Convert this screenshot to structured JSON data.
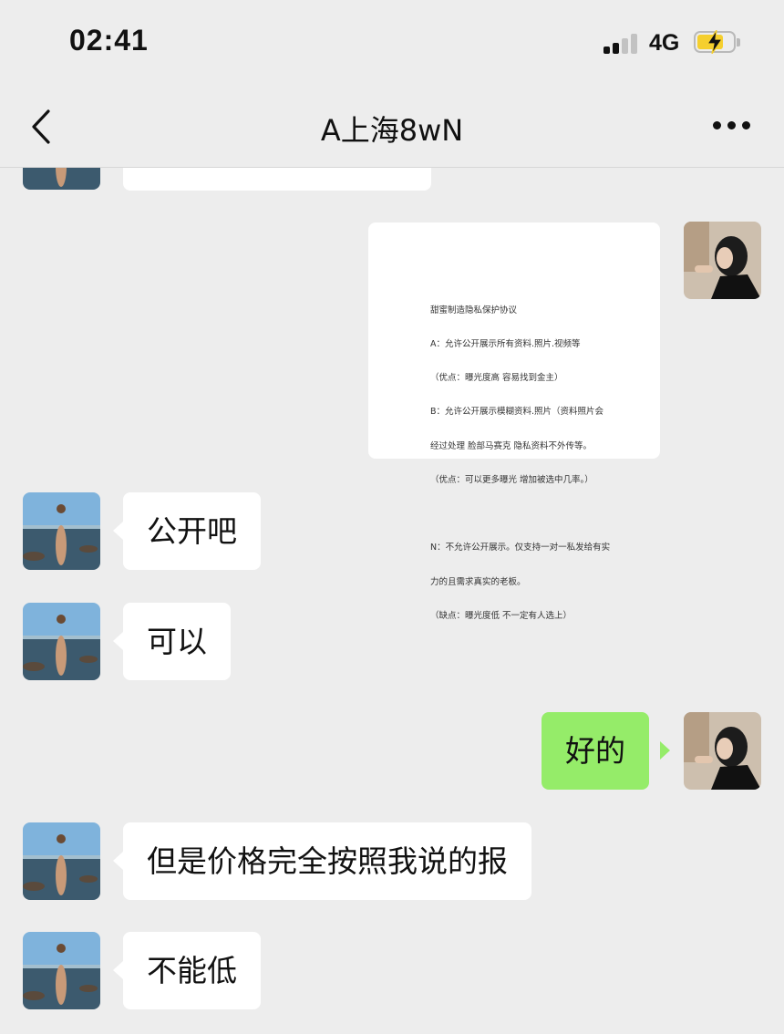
{
  "status_bar": {
    "time": "02:41",
    "network": "4G"
  },
  "nav": {
    "title": "A上海8wN"
  },
  "image_message": {
    "lines": [
      "甜蜜制造隐私保护协议",
      "A：允许公开展示所有资料.照片.视频等",
      "（优点：曝光度高 容易找到金主）",
      "B：允许公开展示模糊资料.照片（资料照片会",
      "经过处理 脸部马赛克 隐私资料不外传等。",
      "（优点：可以更多曝光 增加被选中几率。）",
      "",
      "N：不允许公开展示。仅支持一对一私发给有实",
      "力的且需求真实的老板。",
      "（缺点：曝光度低 不一定有人选上）"
    ]
  },
  "messages": [
    {
      "side": "left",
      "text": "公开吧"
    },
    {
      "side": "left",
      "text": "可以"
    },
    {
      "side": "right",
      "text": "好的"
    },
    {
      "side": "left",
      "text": "但是价格完全按照我说的报"
    },
    {
      "side": "left",
      "text": "不能低"
    }
  ],
  "colors": {
    "background": "#ededed",
    "sent_bubble": "#95ec69",
    "received_bubble": "#ffffff",
    "battery": "#f5cf2e"
  },
  "icons": [
    "signal-icon",
    "battery-charging-icon",
    "back-chevron-icon",
    "more-dots-icon"
  ]
}
